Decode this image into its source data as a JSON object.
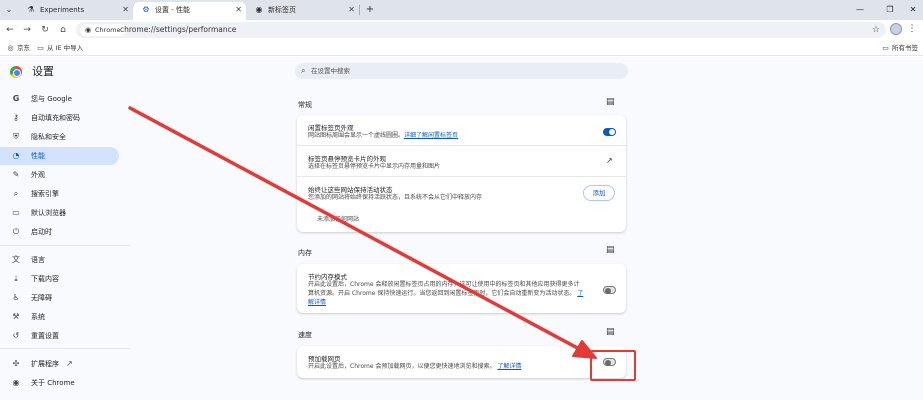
{
  "tabs": [
    {
      "title": "Experiments",
      "icon": "flask-icon"
    },
    {
      "title": "设置 - 性能",
      "icon": "gear-icon"
    },
    {
      "title": "新标签页",
      "icon": "chrome-icon"
    }
  ],
  "toolbar": {
    "chip_label": "Chrome",
    "url": "chrome://settings/performance"
  },
  "bookmarks": {
    "left": [
      {
        "label": "京东",
        "icon": "globe-icon"
      },
      {
        "label": "从 IE 中导入",
        "icon": "folder-icon"
      }
    ],
    "right": {
      "label": "所有书签",
      "icon": "folder-icon"
    }
  },
  "settings": {
    "title": "设置",
    "search_placeholder": "在设置中搜索"
  },
  "nav": [
    {
      "label": "您与 Google",
      "icon": "google-icon"
    },
    {
      "label": "自动填充和密码",
      "icon": "key-icon"
    },
    {
      "label": "隐私和安全",
      "icon": "shield-icon"
    },
    {
      "label": "性能",
      "icon": "speedometer-icon",
      "active": true
    },
    {
      "label": "外观",
      "icon": "palette-icon"
    },
    {
      "label": "搜索引擎",
      "icon": "search-icon"
    },
    {
      "label": "默认浏览器",
      "icon": "browser-icon"
    },
    {
      "label": "启动时",
      "icon": "power-icon"
    },
    {
      "label": "语言",
      "icon": "translate-icon"
    },
    {
      "label": "下载内容",
      "icon": "download-icon"
    },
    {
      "label": "无障碍",
      "icon": "accessibility-icon"
    },
    {
      "label": "系统",
      "icon": "wrench-icon"
    },
    {
      "label": "重置设置",
      "icon": "reset-icon"
    },
    {
      "label": "扩展程序",
      "icon": "puzzle-icon"
    },
    {
      "label": "关于 Chrome",
      "icon": "chrome-icon"
    }
  ],
  "sections": {
    "general": {
      "label": "常规",
      "tab_hover": {
        "title": "闲置标签页外观",
        "desc": "网站图标周围会显示一个虚线圆圈。",
        "link": "详细了解闲置标签页",
        "enabled": true
      },
      "hover_preview": {
        "title": "标签页悬停预览卡片的外观",
        "desc": "选择在标签页悬停预览卡片中显示内存用量和图片"
      },
      "keep_active": {
        "title": "始终让这些网站保持活动状态",
        "desc": "您添加的网站将始终保持活跃状态，且系统不会从它们中释放内存",
        "add_label": "添加",
        "empty_label": "未添加任何网站"
      }
    },
    "memory": {
      "label": "内存",
      "saver": {
        "title": "节约内存模式",
        "desc1": "开启此设置后，Chrome 会释放闲置标签页占用的内存，这可让使用中的标签页和其他应用获得更多计",
        "desc2": "算机资源。开启 Chrome 保持快速运行。当您返回到闲置标签页时，它们会自动重新变为活动状态。",
        "link_tail": "了",
        "link": "解详情",
        "enabled": false
      }
    },
    "speed": {
      "label": "速度",
      "preload": {
        "title": "预加载网页",
        "desc": "开启此设置后，Chrome 会预加载网页，以便您更快速地浏览和搜索。",
        "link": "了解详情",
        "enabled": false
      }
    }
  },
  "colors": {
    "accent": "#0b57d0",
    "annotation": "#e53935"
  }
}
